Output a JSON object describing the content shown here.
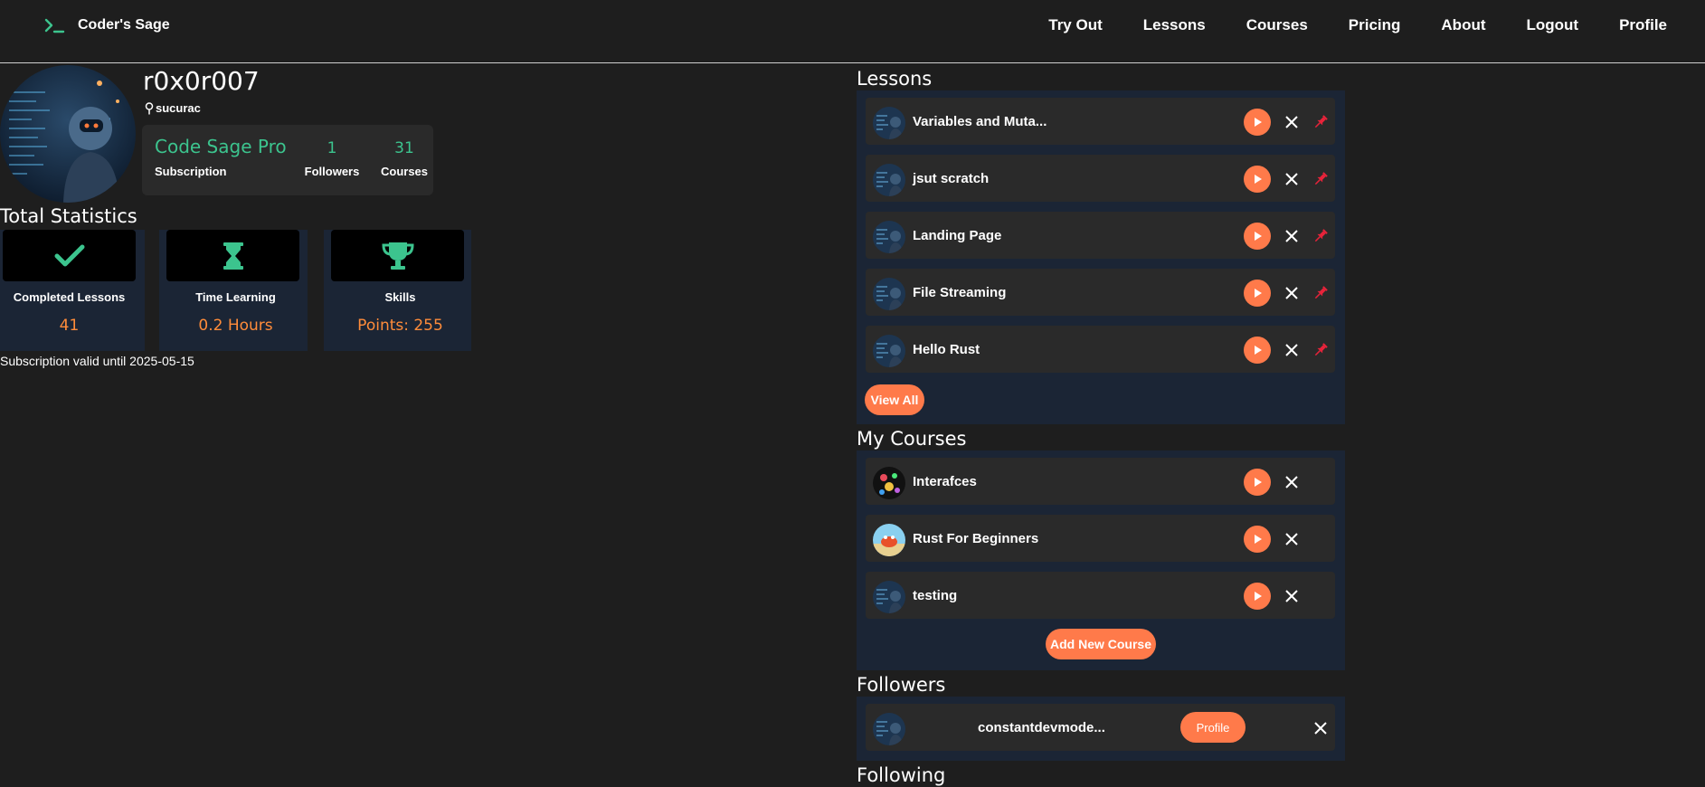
{
  "navbar": {
    "brand": "Coder's Sage",
    "links": [
      "Try Out",
      "Lessons",
      "Courses",
      "Pricing",
      "About",
      "Logout",
      "Profile"
    ]
  },
  "profile": {
    "username": "r0x0r007",
    "location": "sucurac",
    "subscription_name": "Code Sage Pro",
    "subscription_label": "Subscription",
    "followers_count": "1",
    "followers_label": "Followers",
    "courses_count": "31",
    "courses_label": "Courses"
  },
  "statistics": {
    "title": "Total Statistics",
    "cards": [
      {
        "icon": "check-icon",
        "label": "Completed Lessons",
        "value": "41"
      },
      {
        "icon": "hourglass-icon",
        "label": "Time Learning",
        "value": "0.2 Hours"
      },
      {
        "icon": "trophy-icon",
        "label": "Skills",
        "value": "Points: 255"
      }
    ],
    "subscription_valid": "Subscription valid until 2025-05-15"
  },
  "lessons": {
    "title": "Lessons",
    "items": [
      "Variables and Muta...",
      "jsut scratch",
      "Landing Page",
      "File Streaming",
      "Hello Rust"
    ],
    "view_all": "View All"
  },
  "my_courses": {
    "title": "My Courses",
    "items": [
      "Interafces",
      "Rust For Beginners",
      "testing"
    ],
    "add_new": "Add New Course"
  },
  "followers": {
    "title": "Followers",
    "items": [
      {
        "name": "constantdevmode...",
        "button": "Profile"
      }
    ]
  },
  "following": {
    "title": "Following"
  },
  "colors": {
    "accent_green": "#3cc48e",
    "accent_orange": "#ff7a4a",
    "panel_bg": "#1b2535",
    "row_bg": "#2a2a2a"
  }
}
